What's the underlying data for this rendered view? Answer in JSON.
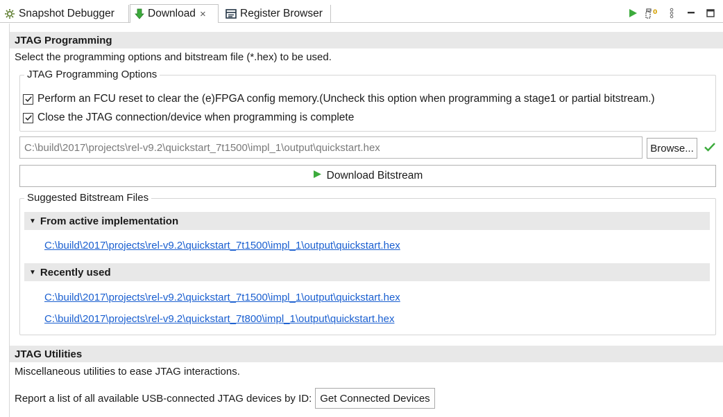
{
  "tabs": [
    {
      "label": "Snapshot Debugger",
      "icon": "gear-bug-icon"
    },
    {
      "label": "Download",
      "icon": "download-arrow-icon",
      "active": true,
      "close": "×"
    },
    {
      "label": "Register Browser",
      "icon": "register-table-icon"
    }
  ],
  "toolbar": {
    "icons": [
      "run-icon",
      "counter-icon",
      "view-menu-icon",
      "minimize-icon",
      "maximize-icon"
    ],
    "counter_badge": "0"
  },
  "jtag_programming": {
    "title": "JTAG Programming",
    "description": "Select the programming options and bitstream file (*.hex) to be used.",
    "options_group_title": "JTAG Programming Options",
    "options": [
      {
        "label": "Perform an FCU reset to clear the (e)FPGA config memory.(Uncheck this option when programming a stage1 or partial bitstream.)",
        "checked": true
      },
      {
        "label": "Close the JTAG connection/device when programming is complete",
        "checked": true
      }
    ],
    "file_path": "C:\\build\\2017\\projects\\rel-v9.2\\quickstart_7t1500\\impl_1\\output\\quickstart.hex",
    "browse_label": "Browse...",
    "download_label": "Download Bitstream"
  },
  "suggested": {
    "group_title": "Suggested Bitstream Files",
    "from_active": {
      "title": "From active implementation",
      "files": [
        "C:\\build\\2017\\projects\\rel-v9.2\\quickstart_7t1500\\impl_1\\output\\quickstart.hex"
      ]
    },
    "recent": {
      "title": "Recently used",
      "files": [
        "C:\\build\\2017\\projects\\rel-v9.2\\quickstart_7t1500\\impl_1\\output\\quickstart.hex",
        "C:\\build\\2017\\projects\\rel-v9.2\\quickstart_7t800\\impl_1\\output\\quickstart.hex"
      ]
    }
  },
  "jtag_utilities": {
    "title": "JTAG Utilities",
    "description": "Miscellaneous utilities to ease JTAG interactions.",
    "report_label": "Report a list of all available USB-connected JTAG devices by ID:",
    "get_devices_label": "Get Connected Devices"
  },
  "colors": {
    "accent_green": "#3cab3c",
    "link_blue": "#1a5fd0",
    "header_bg": "#e8e8e8"
  }
}
